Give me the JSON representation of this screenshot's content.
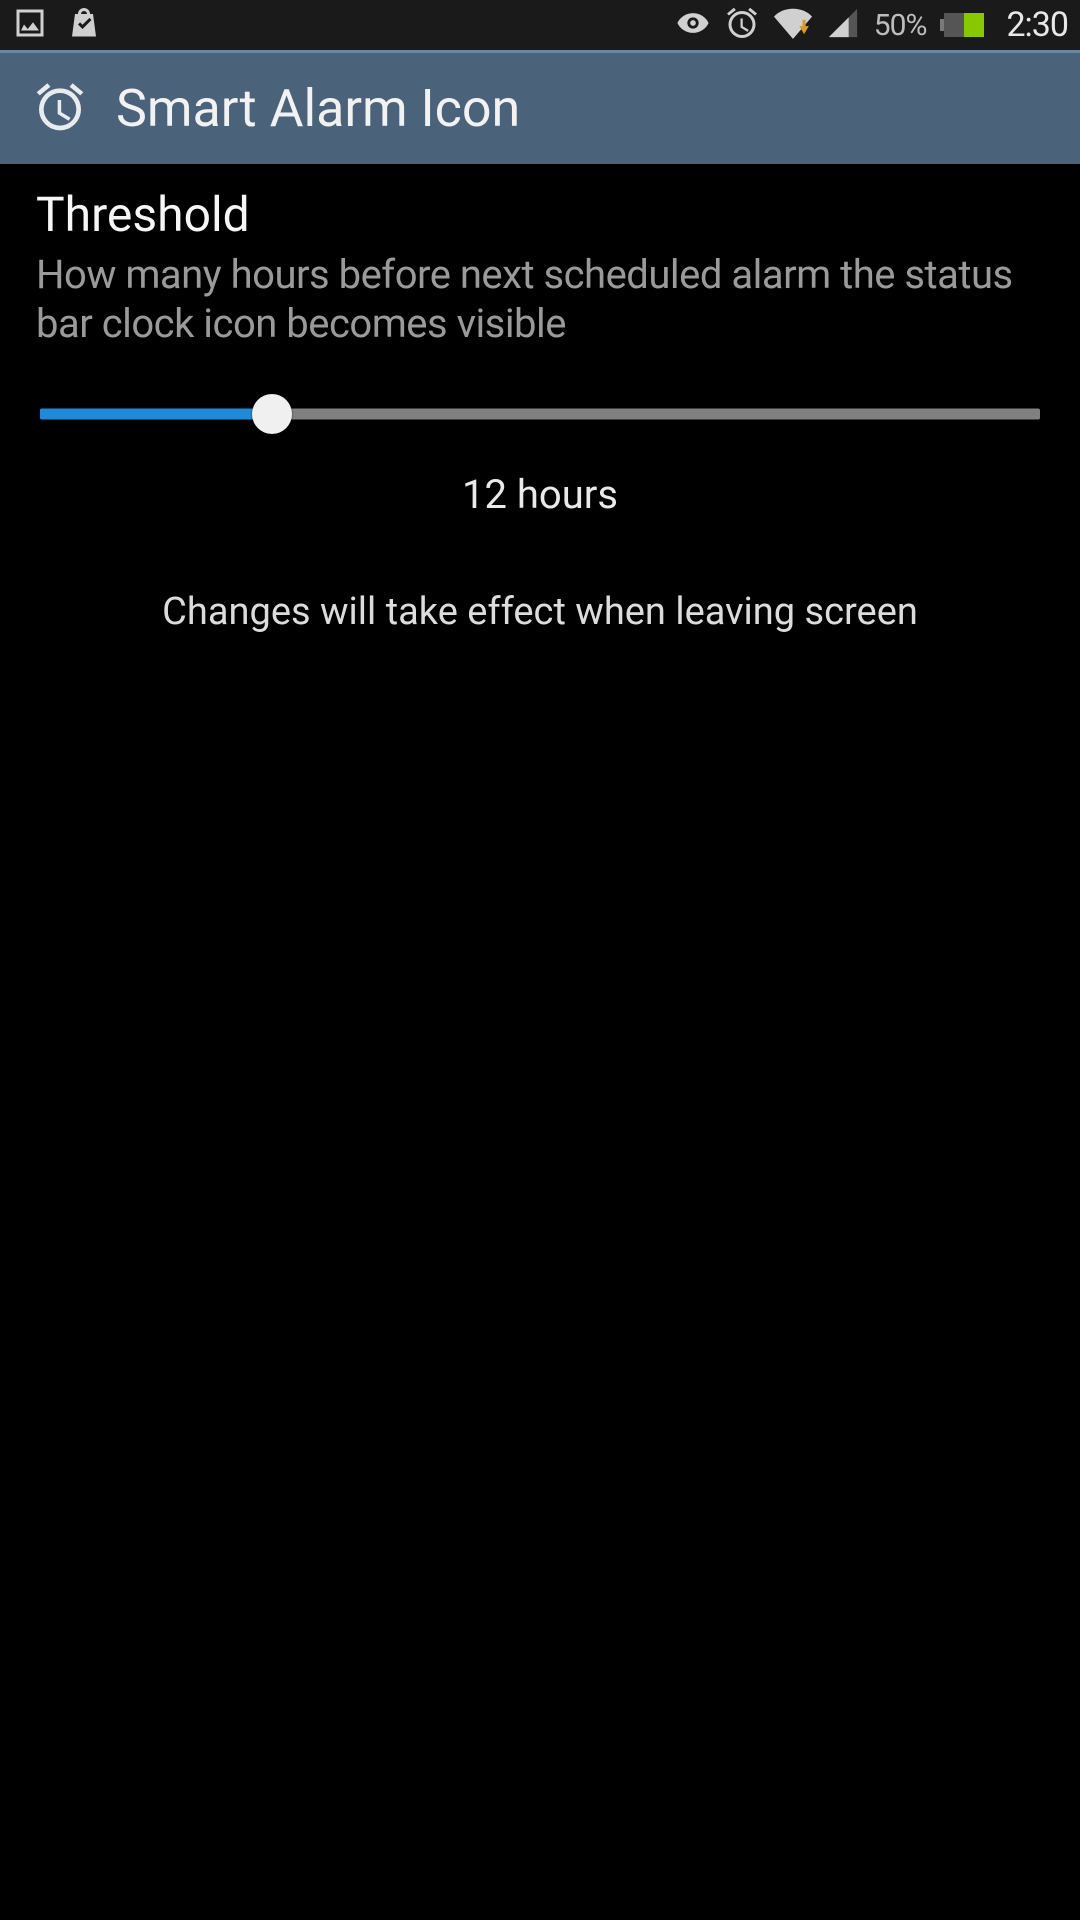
{
  "status": {
    "battery_text": "50%",
    "battery_fill_pct": 50,
    "time": "2:30"
  },
  "header": {
    "title": "Smart Alarm Icon"
  },
  "threshold": {
    "title": "Threshold",
    "description": "How many hours before next scheduled alarm the status bar clock icon becomes visible",
    "slider_percent": 23,
    "value_label": "12 hours",
    "hint": "Changes will take effect when leaving screen"
  },
  "colors": {
    "accent": "#1f8bd8",
    "actionbar": "#4a637b"
  }
}
